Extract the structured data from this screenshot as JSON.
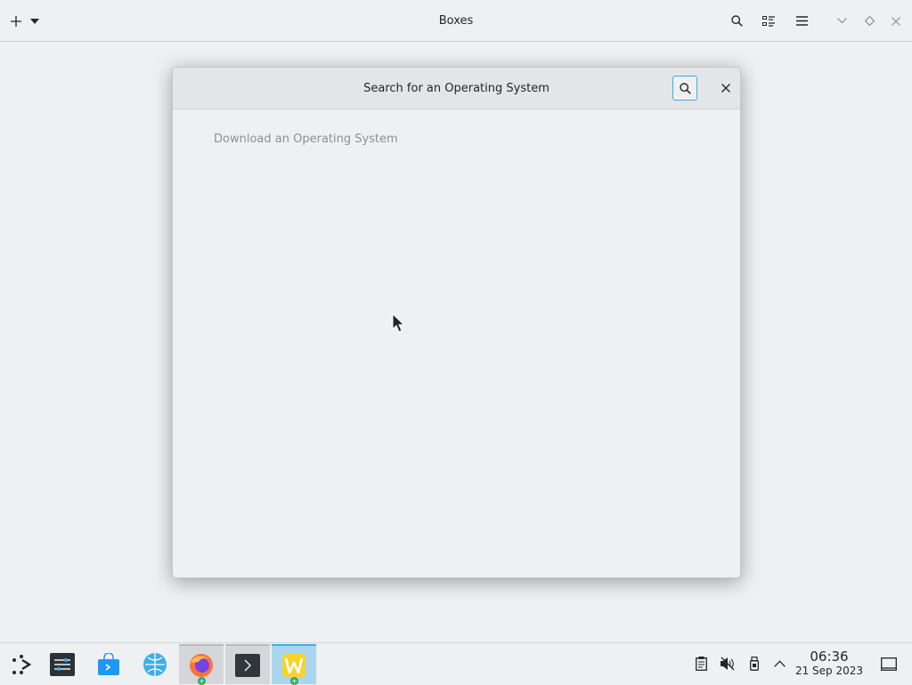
{
  "window": {
    "title": "Boxes"
  },
  "dialog": {
    "title": "Search for an Operating System",
    "section_label": "Download an Operating System"
  },
  "taskbar": {
    "apps": [
      {
        "name": "system-settings"
      },
      {
        "name": "discover"
      },
      {
        "name": "network-browser"
      },
      {
        "name": "firefox"
      },
      {
        "name": "terminal"
      },
      {
        "name": "boxes"
      }
    ],
    "clock": {
      "time": "06:36",
      "date": "21 Sep 2023"
    }
  },
  "colors": {
    "accent": "#3daee9",
    "background": "#eff0f1",
    "active_task": "#a9d5ef"
  }
}
